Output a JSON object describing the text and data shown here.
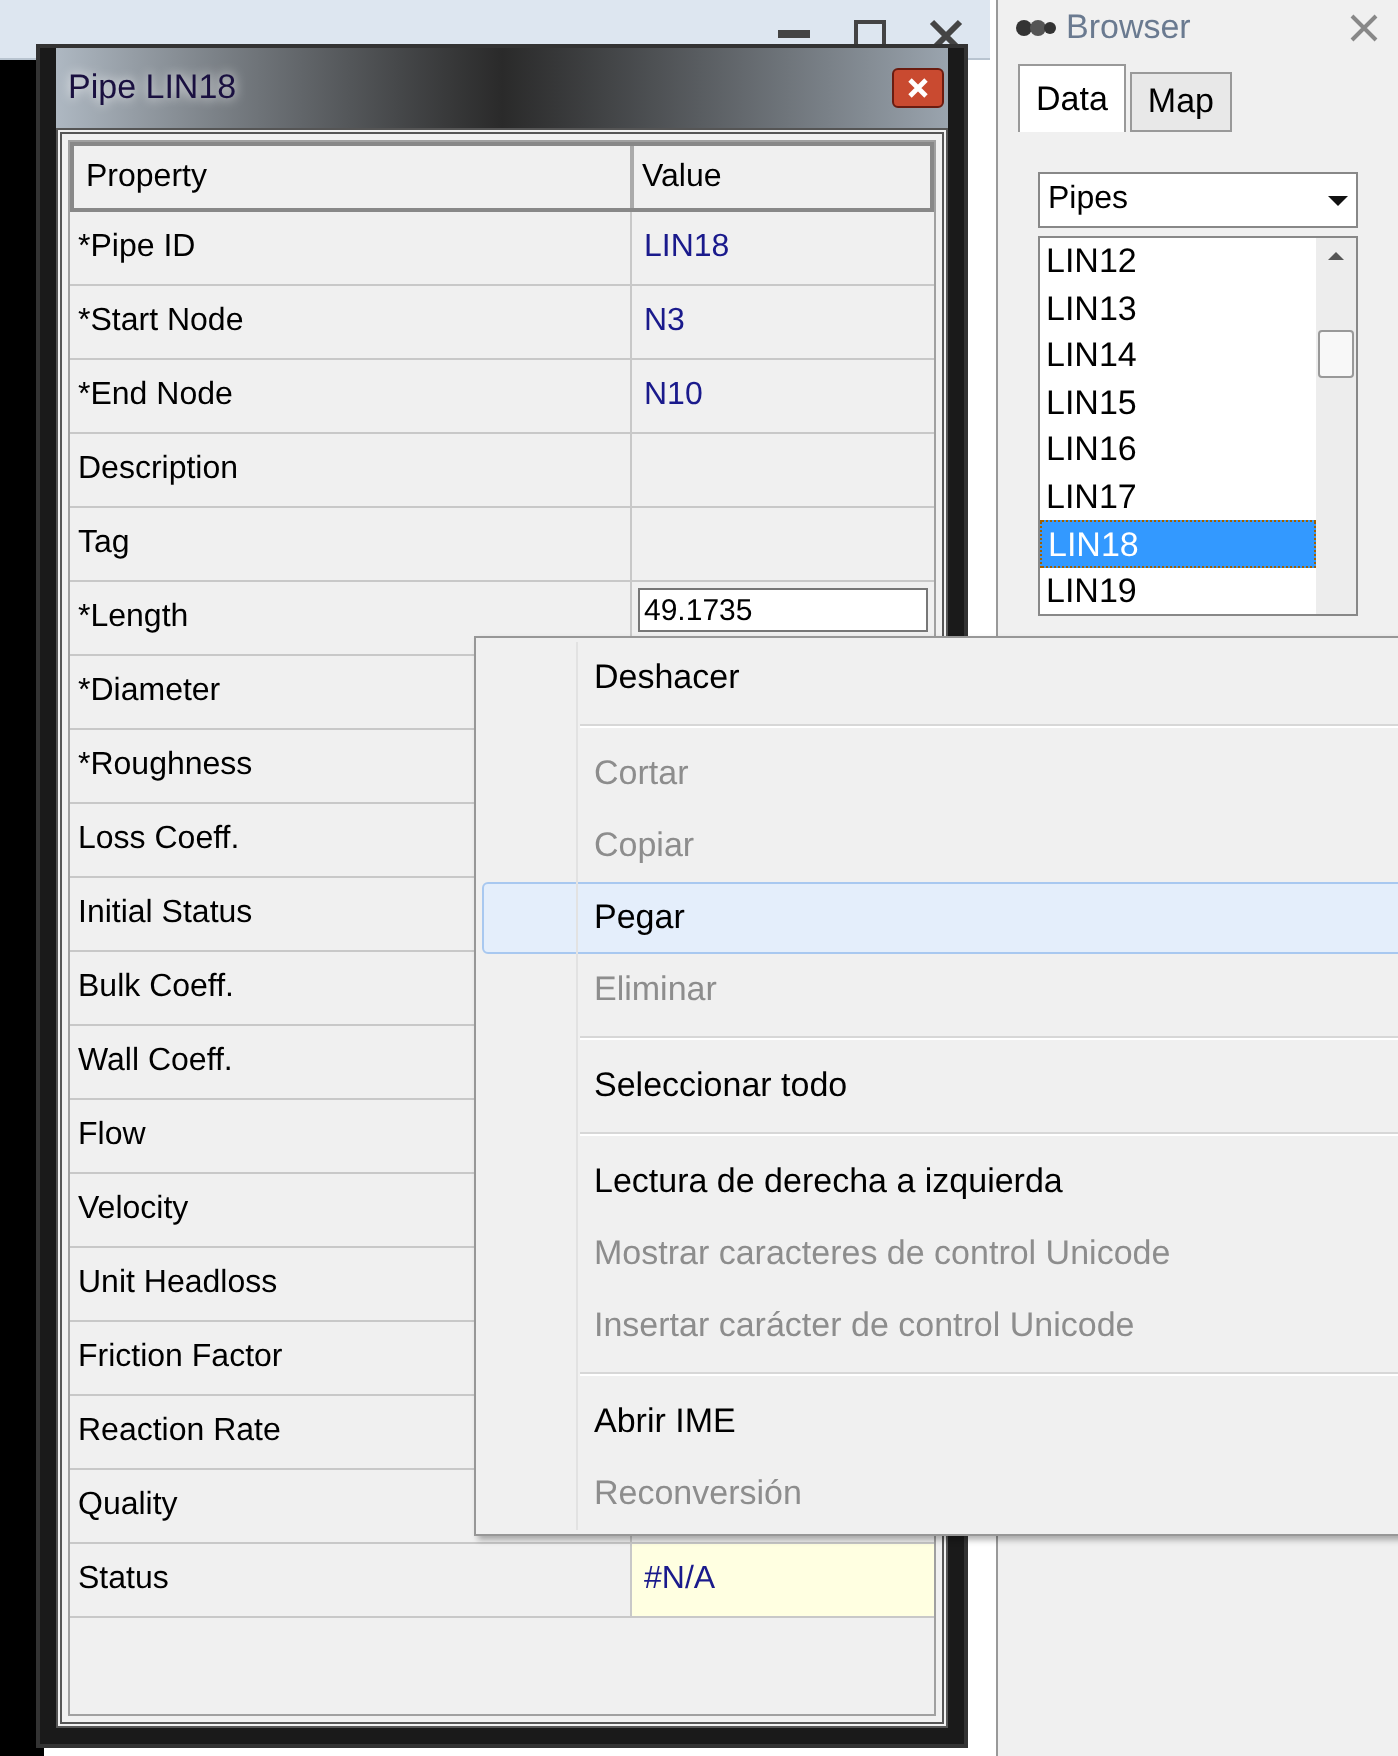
{
  "dialog": {
    "title": "Pipe LIN18"
  },
  "table": {
    "columns": [
      "Property",
      "Value"
    ],
    "rows": [
      {
        "property": "*Pipe ID",
        "value": "LIN18",
        "kind": "plain"
      },
      {
        "property": "*Start Node",
        "value": "N3",
        "kind": "plain"
      },
      {
        "property": "*End Node",
        "value": "N10",
        "kind": "plain"
      },
      {
        "property": "Description",
        "value": "",
        "kind": "plain"
      },
      {
        "property": "Tag",
        "value": "",
        "kind": "plain"
      },
      {
        "property": "*Length",
        "value": "49.1735",
        "kind": "edit"
      },
      {
        "property": "*Diameter"
      },
      {
        "property": "*Roughness"
      },
      {
        "property": "Loss Coeff."
      },
      {
        "property": "Initial Status"
      },
      {
        "property": "Bulk Coeff."
      },
      {
        "property": "Wall Coeff."
      },
      {
        "property": "Flow"
      },
      {
        "property": "Velocity"
      },
      {
        "property": "Unit Headloss"
      },
      {
        "property": "Friction Factor"
      },
      {
        "property": "Reaction Rate"
      },
      {
        "property": "Quality"
      },
      {
        "property": "Status",
        "value": "#N/A",
        "kind": "note"
      }
    ]
  },
  "browser": {
    "title": "Browser",
    "tabs": [
      {
        "label": "Data",
        "selected": true
      },
      {
        "label": "Map",
        "selected": false
      }
    ],
    "category": "Pipes",
    "items": [
      {
        "label": "LIN12",
        "selected": false
      },
      {
        "label": "LIN13",
        "selected": false
      },
      {
        "label": "LIN14",
        "selected": false
      },
      {
        "label": "LIN15",
        "selected": false
      },
      {
        "label": "LIN16",
        "selected": false
      },
      {
        "label": "LIN17",
        "selected": false
      },
      {
        "label": "LIN18",
        "selected": true
      },
      {
        "label": "LIN19",
        "selected": false
      }
    ]
  },
  "context_menu": {
    "groups": [
      [
        {
          "label": "Deshacer",
          "disabled": false,
          "selected": false
        }
      ],
      [
        {
          "label": "Cortar",
          "disabled": true,
          "selected": false
        },
        {
          "label": "Copiar",
          "disabled": true,
          "selected": false
        },
        {
          "label": "Pegar",
          "disabled": false,
          "selected": true
        },
        {
          "label": "Eliminar",
          "disabled": true,
          "selected": false
        }
      ],
      [
        {
          "label": "Seleccionar todo",
          "disabled": false,
          "selected": false
        }
      ],
      [
        {
          "label": "Lectura de derecha a izquierda",
          "disabled": false,
          "selected": false
        },
        {
          "label": "Mostrar caracteres de control Unicode",
          "disabled": true,
          "selected": false
        },
        {
          "label": "Insertar carácter de control Unicode",
          "disabled": true,
          "selected": false
        }
      ],
      [
        {
          "label": "Abrir IME",
          "disabled": false,
          "selected": false
        },
        {
          "label": "Reconversión",
          "disabled": true,
          "selected": false
        }
      ]
    ]
  }
}
